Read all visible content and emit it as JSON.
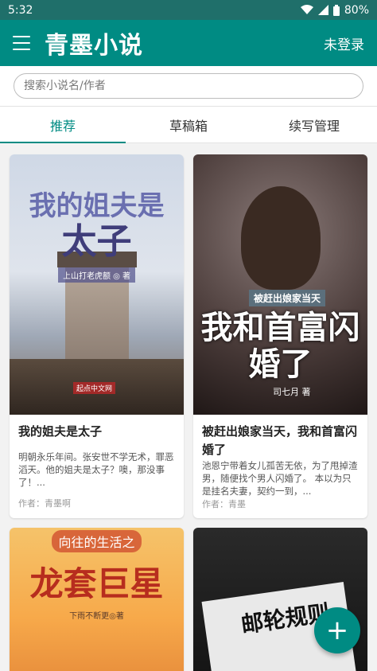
{
  "status": {
    "time": "5:32",
    "battery": "80%"
  },
  "appbar": {
    "title": "青墨小说",
    "login": "未登录"
  },
  "search": {
    "placeholder": "搜索小说名/作者"
  },
  "tabs": [
    "推荐",
    "草稿箱",
    "续写管理"
  ],
  "books": [
    {
      "title": "我的姐夫是太子",
      "desc": "明朝永乐年间。张安世不学无术，罪恶滔天。他的姐夫是太子？噢，那没事了！...",
      "author": "作者：青墨啊",
      "cover_title_1": "我的姐夫是",
      "cover_title_2": "太子",
      "cover_author": "上山打老虎额 ◎ 著",
      "cover_pub": "起点中文网"
    },
    {
      "title": "被赶出娘家当天，我和首富闪婚了",
      "desc": "池恩宁带着女儿孤苦无依，为了甩掉渣男，随便找个男人闪婚了。 本以为只是挂名夫妻，契约一到，...",
      "author": "作者：青墨",
      "cover_sub": "被赶出娘家当天",
      "cover_title": "我和首富闪婚了",
      "cover_author": "司七月 著"
    },
    {
      "cover_sub": "向往的生活之",
      "cover_title": "龙套巨星",
      "cover_author": "下雨不断更◎著"
    },
    {
      "cover_title": "邮轮规则"
    }
  ],
  "fab": {
    "icon": "plus-icon",
    "label": "+"
  },
  "colors": {
    "primary": "#008b83",
    "statusbar": "#1f6f6a"
  }
}
